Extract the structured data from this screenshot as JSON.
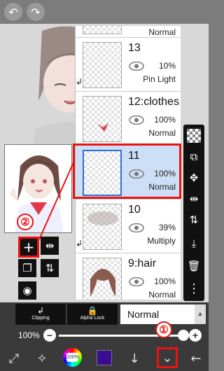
{
  "top_bar": {
    "undo_icon": "undo-icon",
    "redo_icon": "redo-icon"
  },
  "layers": [
    {
      "name": "",
      "opacity": "",
      "blend": "Normal",
      "selected": false,
      "clipped": false
    },
    {
      "name": "13",
      "opacity": "10%",
      "blend": "Pin Light",
      "selected": false,
      "clipped": true
    },
    {
      "name": "12:clothes",
      "opacity": "100%",
      "blend": "Normal",
      "selected": false,
      "clipped": false
    },
    {
      "name": "11",
      "opacity": "100%",
      "blend": "Normal",
      "selected": true,
      "clipped": false
    },
    {
      "name": "10",
      "opacity": "39%",
      "blend": "Multiply",
      "selected": false,
      "clipped": true
    },
    {
      "name": "9:hair",
      "opacity": "100%",
      "blend": "Normal",
      "selected": false,
      "clipped": false
    }
  ],
  "layer_bar": {
    "clipping_label": "Clipping",
    "alpha_lock_label": "Alpha Lock",
    "blend_mode": "Normal"
  },
  "opacity": {
    "label": "100%",
    "value_fraction": 1.0
  },
  "annotations": {
    "badge1": "①",
    "badge2": "②"
  },
  "toolbar": {
    "color_wheel_label": "100%",
    "current_color": "#3a0b93"
  },
  "colors": {
    "selection_accent": "#2f6ed8",
    "annotation_red": "#e11111"
  }
}
